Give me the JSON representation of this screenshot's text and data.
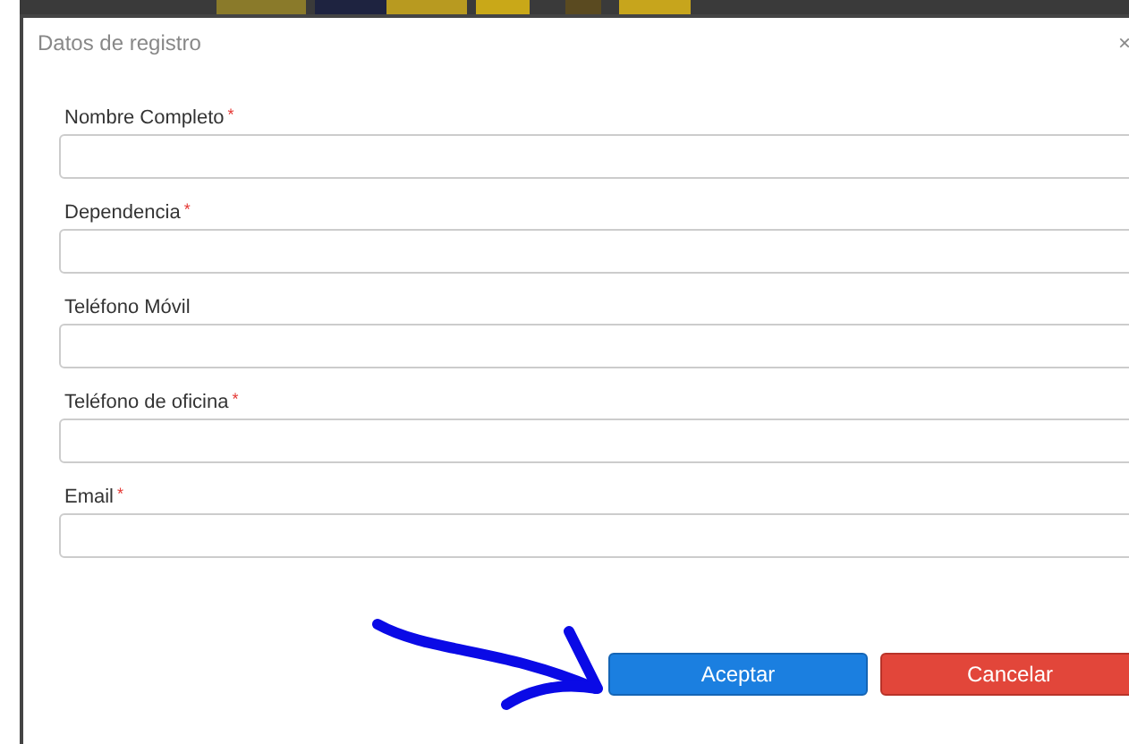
{
  "dialog": {
    "title": "Datos de registro",
    "close": "×"
  },
  "fields": [
    {
      "label": "Nombre Completo",
      "required": true
    },
    {
      "label": "Dependencia",
      "required": true
    },
    {
      "label": "Teléfono Móvil",
      "required": false
    },
    {
      "label": "Teléfono de oficina",
      "required": true
    },
    {
      "label": "Email",
      "required": true
    }
  ],
  "required_mark": "*",
  "buttons": [
    {
      "label": "Aceptar",
      "kind": "primary"
    },
    {
      "label": "Cancelar",
      "kind": "danger"
    }
  ]
}
